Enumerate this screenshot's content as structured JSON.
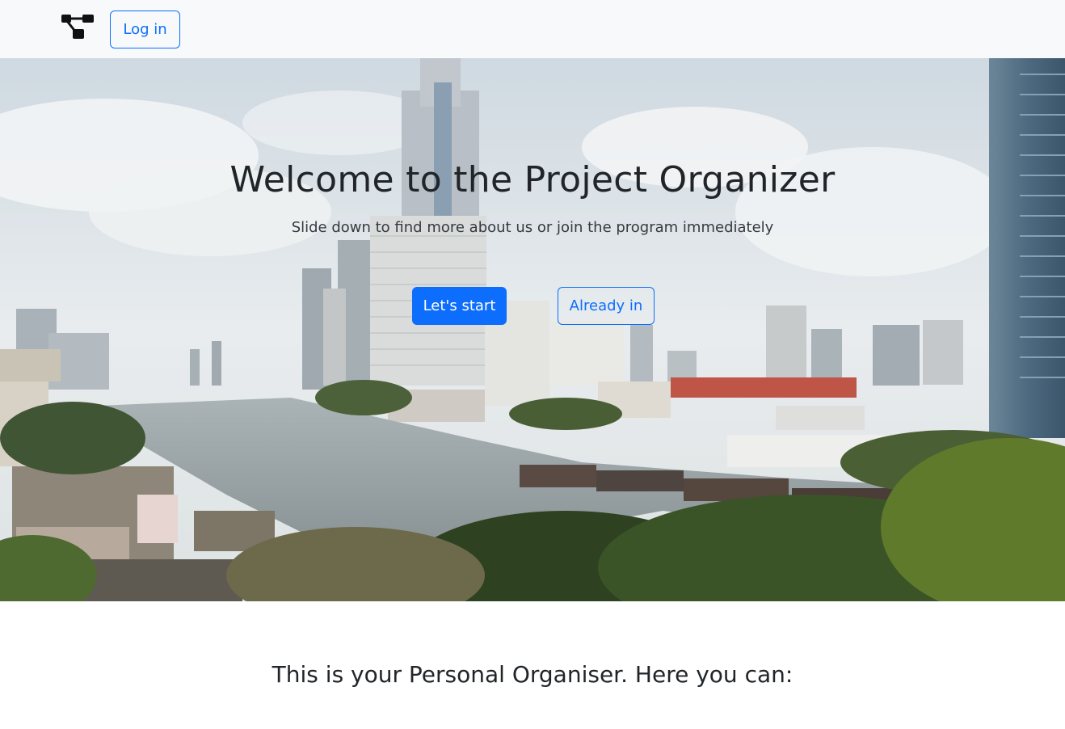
{
  "navbar": {
    "brand_icon": "hierarchy-nodes-icon",
    "login_label": "Log in"
  },
  "hero": {
    "title": "Welcome to the Project Organizer",
    "subtitle": "Slide down to find more about us or join the program immediately",
    "primary_button_label": "Let's start",
    "secondary_button_label": "Already in",
    "background_image": "city-river-skyline"
  },
  "section": {
    "heading": "This is your Personal Organiser. Here you can:"
  },
  "colors": {
    "primary": "#0d6efd",
    "navbar_bg": "#f8f9fa",
    "text": "#212529"
  }
}
